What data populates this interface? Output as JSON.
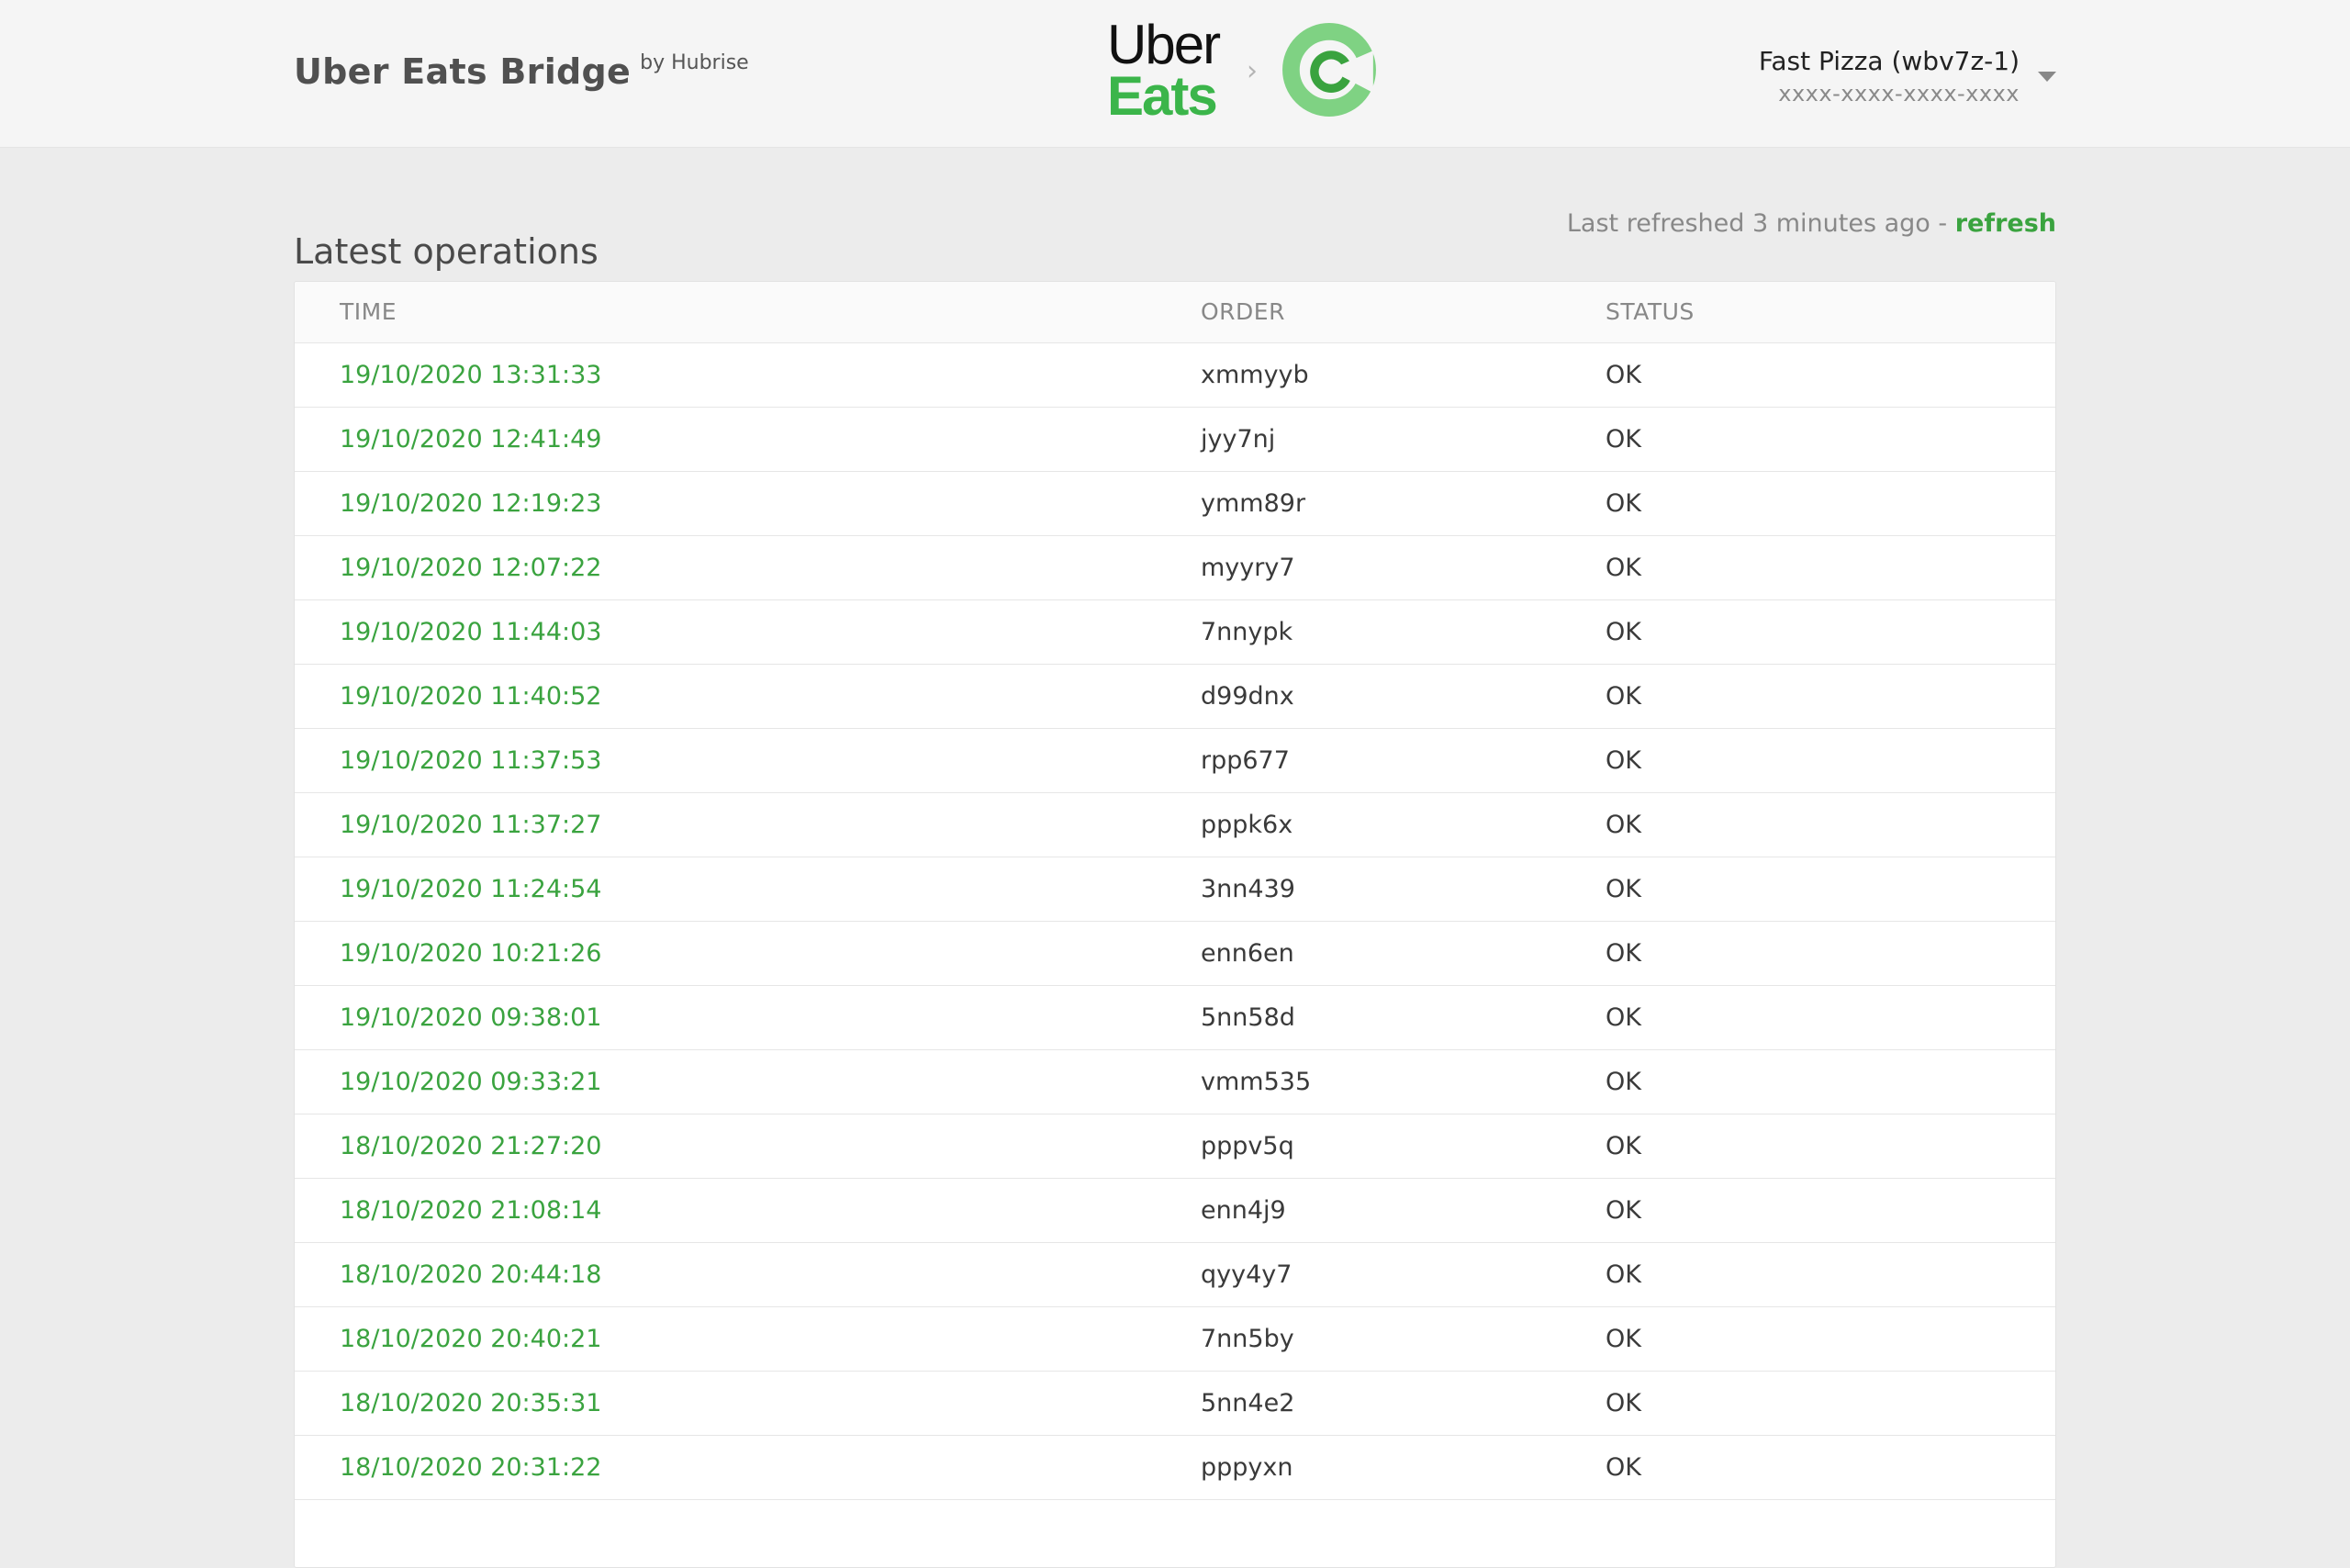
{
  "header": {
    "title": "Uber Eats Bridge",
    "by": "by Hubrise",
    "logo_uber": "Uber",
    "logo_eats": "Eats",
    "account_name": "Fast Pizza (wbv7z-1)",
    "account_id": "xxxx-xxxx-xxxx-xxxx"
  },
  "main": {
    "title": "Latest operations",
    "refresh_text": "Last refreshed 3 minutes ago - ",
    "refresh_link": "refresh"
  },
  "table": {
    "columns": [
      "TIME",
      "ORDER",
      "STATUS"
    ],
    "rows": [
      {
        "time": "19/10/2020 13:31:33",
        "order": "xmmyyb",
        "status": "OK"
      },
      {
        "time": "19/10/2020 12:41:49",
        "order": "jyy7nj",
        "status": "OK"
      },
      {
        "time": "19/10/2020 12:19:23",
        "order": "ymm89r",
        "status": "OK"
      },
      {
        "time": "19/10/2020 12:07:22",
        "order": "myyry7",
        "status": "OK"
      },
      {
        "time": "19/10/2020 11:44:03",
        "order": "7nnypk",
        "status": "OK"
      },
      {
        "time": "19/10/2020 11:40:52",
        "order": "d99dnx",
        "status": "OK"
      },
      {
        "time": "19/10/2020 11:37:53",
        "order": "rpp677",
        "status": "OK"
      },
      {
        "time": "19/10/2020 11:37:27",
        "order": "pppk6x",
        "status": "OK"
      },
      {
        "time": "19/10/2020 11:24:54",
        "order": "3nn439",
        "status": "OK"
      },
      {
        "time": "19/10/2020 10:21:26",
        "order": "enn6en",
        "status": "OK"
      },
      {
        "time": "19/10/2020 09:38:01",
        "order": "5nn58d",
        "status": "OK"
      },
      {
        "time": "19/10/2020 09:33:21",
        "order": "vmm535",
        "status": "OK"
      },
      {
        "time": "18/10/2020 21:27:20",
        "order": "pppv5q",
        "status": "OK"
      },
      {
        "time": "18/10/2020 21:08:14",
        "order": "enn4j9",
        "status": "OK"
      },
      {
        "time": "18/10/2020 20:44:18",
        "order": "qyy4y7",
        "status": "OK"
      },
      {
        "time": "18/10/2020 20:40:21",
        "order": "7nn5by",
        "status": "OK"
      },
      {
        "time": "18/10/2020 20:35:31",
        "order": "5nn4e2",
        "status": "OK"
      },
      {
        "time": "18/10/2020 20:31:22",
        "order": "pppyxn",
        "status": "OK"
      }
    ]
  },
  "colors": {
    "accent": "#3aa33f",
    "uber_green": "#3bb54a",
    "hubrise_green": "#57c05b"
  },
  "icons": [
    "hubrise-logo-icon",
    "chevron-right-icon",
    "caret-down-icon"
  ]
}
